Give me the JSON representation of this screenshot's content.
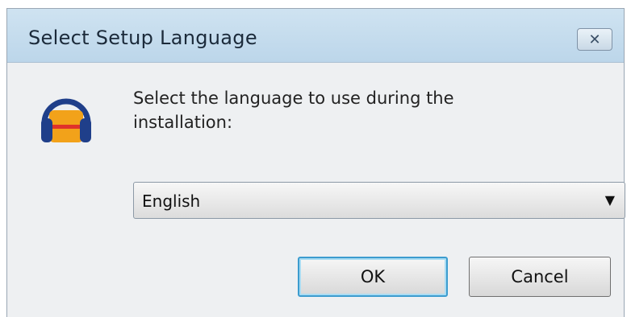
{
  "window": {
    "title": "Select Setup Language",
    "close_glyph": "✕"
  },
  "dialog": {
    "app_icon": "headphones-app-icon",
    "prompt": "Select the language to use during the installation:",
    "language_select": {
      "selected": "English",
      "arrow_glyph": "▼"
    },
    "ok_label": "OK",
    "cancel_label": "Cancel"
  },
  "colors": {
    "titlebar": "#c4dbec",
    "body": "#eef0f2",
    "ok_focus_border": "#3c9ccf",
    "icon_blue": "#1f3f8a",
    "icon_orange": "#f2a21a",
    "icon_red": "#e0322a"
  }
}
